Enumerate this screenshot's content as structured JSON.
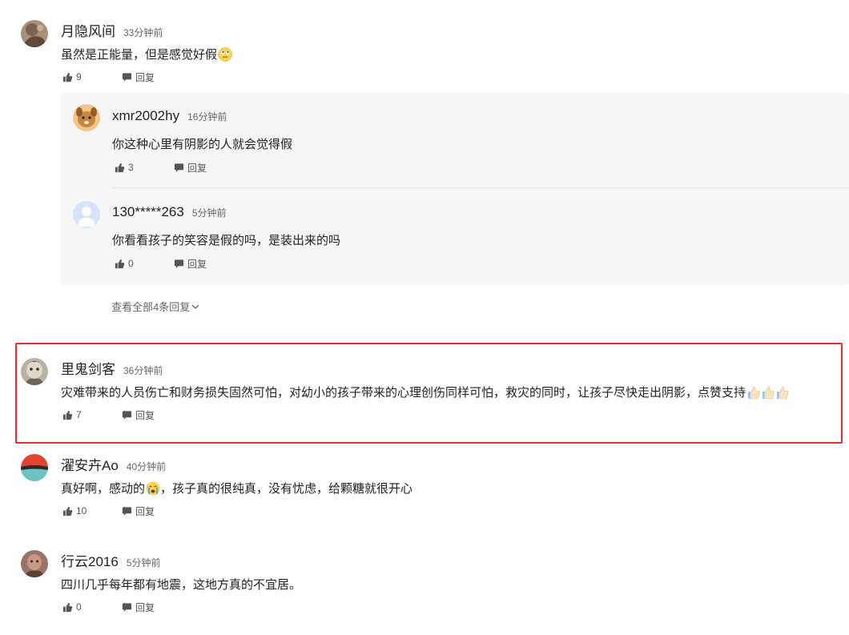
{
  "comments": [
    {
      "user": "月隐风间",
      "time": "33分钟前",
      "text": "虽然是正能量，但是感觉好假",
      "likes": "9",
      "reply_label": "回复",
      "replies": [
        {
          "user": "xmr2002hy",
          "time": "16分钟前",
          "text": "你这种心里有阴影的人就会觉得假",
          "likes": "3",
          "reply_label": "回复"
        },
        {
          "user": "130*****263",
          "time": "5分钟前",
          "text": "你看看孩子的笑容是假的吗，是装出来的吗",
          "likes": "0",
          "reply_label": "回复"
        }
      ],
      "view_all": "查看全部4条回复"
    },
    {
      "user": "里鬼剑客",
      "time": "36分钟前",
      "text": "灾难带来的人员伤亡和财务损失固然可怕，对幼小的孩子带来的心理创伤同样可怕，救灾的同时，让孩子尽快走出阴影，点赞支持",
      "likes": "7",
      "reply_label": "回复"
    },
    {
      "user": "濯安卉Ao",
      "time": "40分钟前",
      "text_before": "真好啊，感动的",
      "text_after": "，孩子真的很纯真，没有忧虑，给颗糖就很开心",
      "likes": "10",
      "reply_label": "回复"
    },
    {
      "user": "行云2016",
      "time": "5分钟前",
      "text": "四川几乎每年都有地震，这地方真的不宜居。",
      "likes": "0",
      "reply_label": "回复"
    }
  ],
  "colors": {
    "highlight_border": "#e0302a",
    "reply_bg": "#f6f6f6"
  },
  "icons": {
    "like": "thumbs-up-icon",
    "reply": "speech-bubble-icon",
    "expand": "chevron-down-icon"
  }
}
